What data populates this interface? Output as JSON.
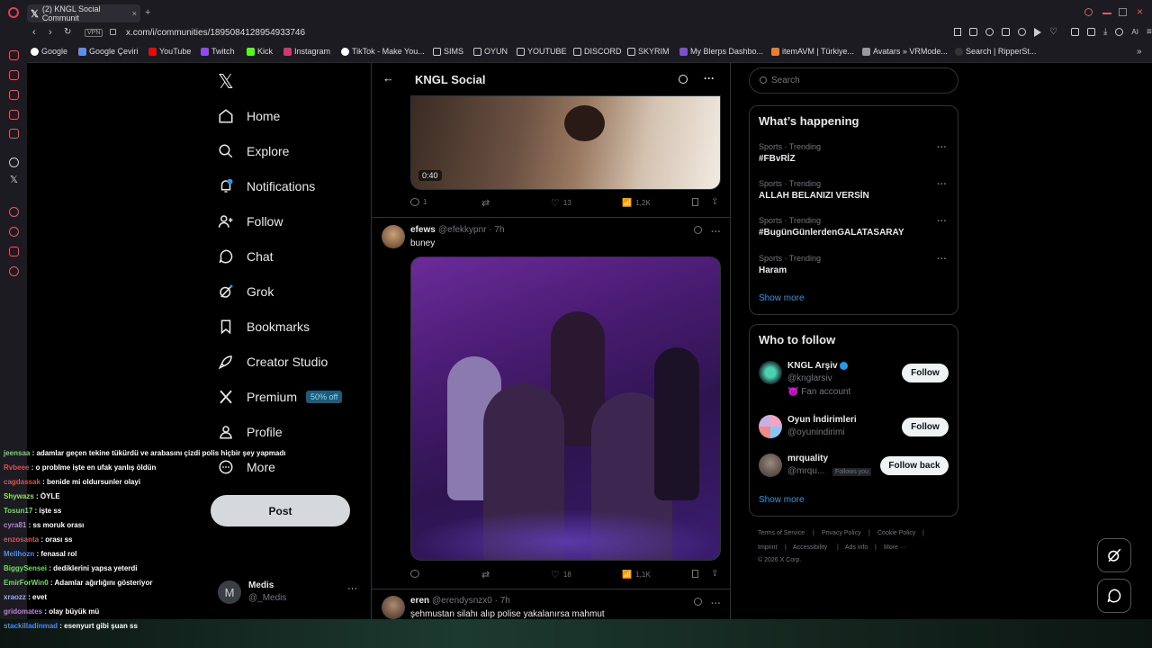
{
  "browser": {
    "tab_title": "(2) KNGL Social Communit",
    "url": "x.com/i/communities/1895084128954933746",
    "vpn_label": "VPN",
    "bookmarks": [
      "Google",
      "Google Çeviri",
      "YouTube",
      "Twitch",
      "Kick",
      "Instagram",
      "TikTok - Make You...",
      "SIMS",
      "OYUN",
      "YOUTUBE",
      "DISCORD",
      "SKYRIM",
      "My Blerps Dashbo...",
      "itemAVM | Türkiye...",
      "Avatars » VRMode...",
      "Search | RipperSt..."
    ],
    "ai_label": "AI"
  },
  "nav": {
    "items": [
      "Home",
      "Explore",
      "Notifications",
      "Follow",
      "Chat",
      "Grok",
      "Bookmarks",
      "Creator Studio",
      "Premium",
      "Profile",
      "More"
    ],
    "premium_badge": "50% off",
    "post_button": "Post",
    "account": {
      "name": "Medis",
      "handle": "@_Medis",
      "avatar_letter": "M"
    }
  },
  "header": {
    "title": "KNGL Social"
  },
  "posts": [
    {
      "video_time": "0:40",
      "replies": "1",
      "likes": "13",
      "views": "1,2K"
    },
    {
      "name": "efews",
      "handle": "@efekkypnr · 7h",
      "text": "buney",
      "likes": "18",
      "views": "1,1K"
    },
    {
      "name": "eren",
      "handle": "@erendysnzx0 · 7h",
      "text": "şehmustan silahı alıp polise yakalanırsa mahmut"
    }
  ],
  "search": {
    "placeholder": "Search"
  },
  "happening": {
    "title": "What’s happening",
    "trends": [
      {
        "meta": "Sports · Trending",
        "title": "#FBvRİZ"
      },
      {
        "meta": "Sports · Trending",
        "title": "ALLAH BELANIZI VERSİN"
      },
      {
        "meta": "Sports · Trending",
        "title": "#BugünGünlerdenGALATASARAY"
      },
      {
        "meta": "Sports · Trending",
        "title": "Haram"
      }
    ],
    "show_more": "Show more"
  },
  "who_to_follow": {
    "title": "Who to follow",
    "users": [
      {
        "name": "KNGL Arşiv",
        "handle": "@knglarsiv",
        "extra": "😈 Fan account",
        "button": "Follow"
      },
      {
        "name": "Oyun İndirimleri",
        "handle": "@oyunindirimi",
        "button": "Follow"
      },
      {
        "name": "mrquality",
        "handle": "@mrqu...",
        "badge": "Follows you",
        "button": "Follow back"
      }
    ],
    "show_more": "Show more"
  },
  "footer": {
    "links": [
      "Terms of Service",
      "Privacy Policy",
      "Cookie Policy",
      "Imprint",
      "Accessibility",
      "Ads info",
      "More ···"
    ],
    "copyright": "© 2026 X Corp."
  },
  "chat_overlay": [
    {
      "user": "jeensaa",
      "color": "#6be05c",
      "msg": ": adamlar geçen tekine tükürdü ve arabasını çizdi polis hiçbir şey yapmadı"
    },
    {
      "user": "Rvbeee",
      "color": "#e05050",
      "msg": ": o problme işte en ufak yanlış öldün"
    },
    {
      "user": "cagdassak",
      "color": "#e05050",
      "msg": ": benide mi oldursunler olayi"
    },
    {
      "user": "Shywazs",
      "color": "#9be05c",
      "msg": ": ÖYLE"
    },
    {
      "user": "Tosun17",
      "color": "#6be05c",
      "msg": ": işte ss"
    },
    {
      "user": "cyra81",
      "color": "#c07ee0",
      "msg": ": ss moruk orası"
    },
    {
      "user": "enzosanta",
      "color": "#e05050",
      "msg": ": orası ss"
    },
    {
      "user": "Melihozn",
      "color": "#4a8cf0",
      "msg": ": fenasal rol"
    },
    {
      "user": "BiggySensei",
      "color": "#6be05c",
      "msg": ": dediklerini yapsa yeterdi"
    },
    {
      "user": "EmirForWin0",
      "color": "#6be05c",
      "msg": ": Adamlar ağırlığını gösteriyor"
    },
    {
      "user": "xraozz",
      "color": "#9aa8ff",
      "msg": ": evet"
    },
    {
      "user": "gridomates",
      "color": "#c07ee0",
      "msg": ": olay büyük mü"
    },
    {
      "user": "stackilladinmad",
      "color": "#4a8cf0",
      "msg": ": esenyurt gibi şuan ss"
    }
  ]
}
